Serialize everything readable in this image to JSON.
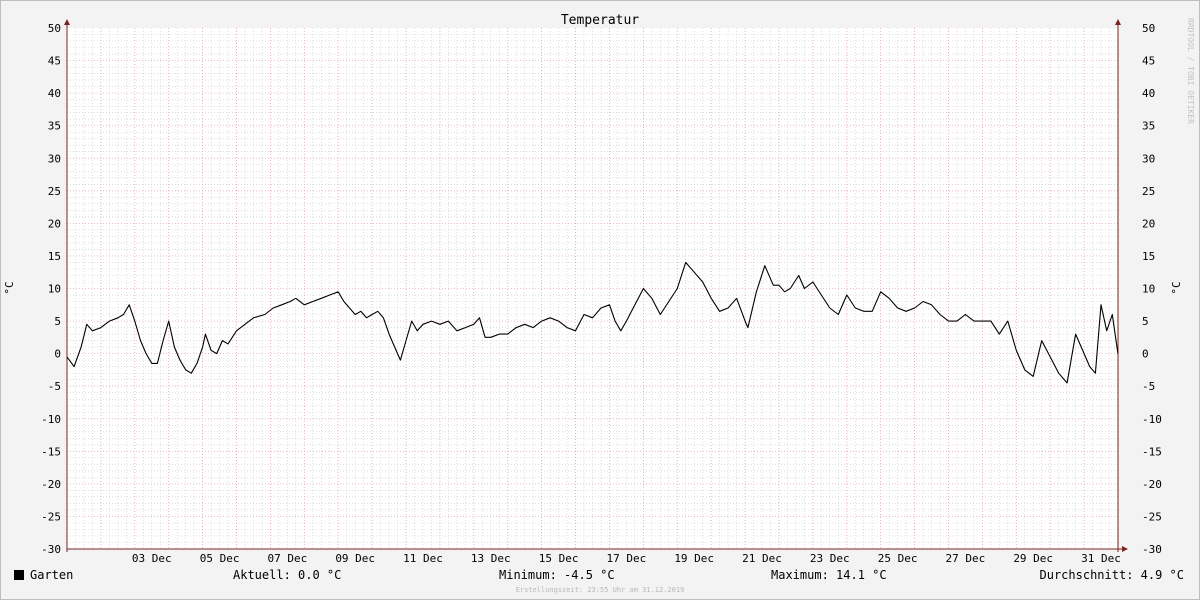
{
  "chart_data": {
    "type": "line",
    "title": "Temperatur",
    "ylabel": "°C",
    "ylim": [
      -30,
      50
    ],
    "yticks": [
      50,
      45,
      40,
      35,
      30,
      25,
      20,
      15,
      10,
      5,
      0,
      -5,
      -10,
      -15,
      -20,
      -25,
      -30
    ],
    "xlim": [
      "2019-12-01",
      "2020-01-01"
    ],
    "xticks": [
      {
        "date": "2019-12-03",
        "label": "03 Dec"
      },
      {
        "date": "2019-12-05",
        "label": "05 Dec"
      },
      {
        "date": "2019-12-07",
        "label": "07 Dec"
      },
      {
        "date": "2019-12-09",
        "label": "09 Dec"
      },
      {
        "date": "2019-12-11",
        "label": "11 Dec"
      },
      {
        "date": "2019-12-13",
        "label": "13 Dec"
      },
      {
        "date": "2019-12-15",
        "label": "15 Dec"
      },
      {
        "date": "2019-12-17",
        "label": "17 Dec"
      },
      {
        "date": "2019-12-19",
        "label": "19 Dec"
      },
      {
        "date": "2019-12-21",
        "label": "21 Dec"
      },
      {
        "date": "2019-12-23",
        "label": "23 Dec"
      },
      {
        "date": "2019-12-25",
        "label": "25 Dec"
      },
      {
        "date": "2019-12-27",
        "label": "27 Dec"
      },
      {
        "date": "2019-12-29",
        "label": "29 Dec"
      },
      {
        "date": "2019-12-31",
        "label": "31 Dec"
      }
    ],
    "grid": true,
    "series": [
      {
        "name": "Garten",
        "color": "#000000",
        "points": [
          [
            "2019-12-01 00:00",
            -0.5
          ],
          [
            "2019-12-01 05:00",
            -2.0
          ],
          [
            "2019-12-01 10:00",
            1.0
          ],
          [
            "2019-12-01 14:00",
            4.5
          ],
          [
            "2019-12-01 18:00",
            3.5
          ],
          [
            "2019-12-02 00:00",
            4.0
          ],
          [
            "2019-12-02 06:00",
            5.0
          ],
          [
            "2019-12-02 12:00",
            5.5
          ],
          [
            "2019-12-02 16:00",
            6.0
          ],
          [
            "2019-12-02 20:00",
            7.5
          ],
          [
            "2019-12-03 00:00",
            5.0
          ],
          [
            "2019-12-03 04:00",
            2.0
          ],
          [
            "2019-12-03 08:00",
            0.0
          ],
          [
            "2019-12-03 12:00",
            -1.5
          ],
          [
            "2019-12-03 16:00",
            -1.5
          ],
          [
            "2019-12-03 20:00",
            2.0
          ],
          [
            "2019-12-04 00:00",
            5.0
          ],
          [
            "2019-12-04 04:00",
            1.0
          ],
          [
            "2019-12-04 08:00",
            -1.0
          ],
          [
            "2019-12-04 12:00",
            -2.5
          ],
          [
            "2019-12-04 16:00",
            -3.0
          ],
          [
            "2019-12-04 20:00",
            -1.5
          ],
          [
            "2019-12-05 00:00",
            1.0
          ],
          [
            "2019-12-05 02:00",
            3.0
          ],
          [
            "2019-12-05 06:00",
            0.5
          ],
          [
            "2019-12-05 10:00",
            0.0
          ],
          [
            "2019-12-05 14:00",
            2.0
          ],
          [
            "2019-12-05 18:00",
            1.5
          ],
          [
            "2019-12-06 00:00",
            3.5
          ],
          [
            "2019-12-06 06:00",
            4.5
          ],
          [
            "2019-12-06 12:00",
            5.5
          ],
          [
            "2019-12-06 20:00",
            6.0
          ],
          [
            "2019-12-07 02:00",
            7.0
          ],
          [
            "2019-12-07 08:00",
            7.5
          ],
          [
            "2019-12-07 14:00",
            8.0
          ],
          [
            "2019-12-07 18:00",
            8.5
          ],
          [
            "2019-12-08 00:00",
            7.5
          ],
          [
            "2019-12-08 06:00",
            8.0
          ],
          [
            "2019-12-08 12:00",
            8.5
          ],
          [
            "2019-12-08 18:00",
            9.0
          ],
          [
            "2019-12-09 00:00",
            9.5
          ],
          [
            "2019-12-09 04:00",
            8.0
          ],
          [
            "2019-12-09 08:00",
            7.0
          ],
          [
            "2019-12-09 12:00",
            6.0
          ],
          [
            "2019-12-09 16:00",
            6.5
          ],
          [
            "2019-12-09 20:00",
            5.5
          ],
          [
            "2019-12-10 00:00",
            6.0
          ],
          [
            "2019-12-10 04:00",
            6.5
          ],
          [
            "2019-12-10 08:00",
            5.5
          ],
          [
            "2019-12-10 12:00",
            3.0
          ],
          [
            "2019-12-10 16:00",
            1.0
          ],
          [
            "2019-12-10 20:00",
            -1.0
          ],
          [
            "2019-12-11 00:00",
            2.0
          ],
          [
            "2019-12-11 04:00",
            5.0
          ],
          [
            "2019-12-11 08:00",
            3.5
          ],
          [
            "2019-12-11 12:00",
            4.5
          ],
          [
            "2019-12-11 18:00",
            5.0
          ],
          [
            "2019-12-12 00:00",
            4.5
          ],
          [
            "2019-12-12 06:00",
            5.0
          ],
          [
            "2019-12-12 12:00",
            3.5
          ],
          [
            "2019-12-12 18:00",
            4.0
          ],
          [
            "2019-12-13 00:00",
            4.5
          ],
          [
            "2019-12-13 04:00",
            5.5
          ],
          [
            "2019-12-13 08:00",
            2.5
          ],
          [
            "2019-12-13 12:00",
            2.5
          ],
          [
            "2019-12-13 18:00",
            3.0
          ],
          [
            "2019-12-14 00:00",
            3.0
          ],
          [
            "2019-12-14 06:00",
            4.0
          ],
          [
            "2019-12-14 12:00",
            4.5
          ],
          [
            "2019-12-14 18:00",
            4.0
          ],
          [
            "2019-12-15 00:00",
            5.0
          ],
          [
            "2019-12-15 06:00",
            5.5
          ],
          [
            "2019-12-15 12:00",
            5.0
          ],
          [
            "2019-12-15 18:00",
            4.0
          ],
          [
            "2019-12-16 00:00",
            3.5
          ],
          [
            "2019-12-16 06:00",
            6.0
          ],
          [
            "2019-12-16 12:00",
            5.5
          ],
          [
            "2019-12-16 18:00",
            7.0
          ],
          [
            "2019-12-17 00:00",
            7.5
          ],
          [
            "2019-12-17 04:00",
            5.0
          ],
          [
            "2019-12-17 08:00",
            3.5
          ],
          [
            "2019-12-17 12:00",
            5.0
          ],
          [
            "2019-12-17 18:00",
            7.5
          ],
          [
            "2019-12-18 00:00",
            10.0
          ],
          [
            "2019-12-18 06:00",
            8.5
          ],
          [
            "2019-12-18 12:00",
            6.0
          ],
          [
            "2019-12-18 18:00",
            8.0
          ],
          [
            "2019-12-19 00:00",
            10.0
          ],
          [
            "2019-12-19 06:00",
            14.0
          ],
          [
            "2019-12-19 12:00",
            12.5
          ],
          [
            "2019-12-19 18:00",
            11.0
          ],
          [
            "2019-12-20 00:00",
            8.5
          ],
          [
            "2019-12-20 06:00",
            6.5
          ],
          [
            "2019-12-20 12:00",
            7.0
          ],
          [
            "2019-12-20 18:00",
            8.5
          ],
          [
            "2019-12-21 00:00",
            5.0
          ],
          [
            "2019-12-21 02:00",
            4.0
          ],
          [
            "2019-12-21 08:00",
            9.5
          ],
          [
            "2019-12-21 14:00",
            13.5
          ],
          [
            "2019-12-21 20:00",
            10.5
          ],
          [
            "2019-12-22 00:00",
            10.5
          ],
          [
            "2019-12-22 04:00",
            9.5
          ],
          [
            "2019-12-22 08:00",
            10.0
          ],
          [
            "2019-12-22 14:00",
            12.0
          ],
          [
            "2019-12-22 18:00",
            10.0
          ],
          [
            "2019-12-23 00:00",
            11.0
          ],
          [
            "2019-12-23 06:00",
            9.0
          ],
          [
            "2019-12-23 12:00",
            7.0
          ],
          [
            "2019-12-23 18:00",
            6.0
          ],
          [
            "2019-12-24 00:00",
            9.0
          ],
          [
            "2019-12-24 06:00",
            7.0
          ],
          [
            "2019-12-24 12:00",
            6.5
          ],
          [
            "2019-12-24 18:00",
            6.5
          ],
          [
            "2019-12-25 00:00",
            9.5
          ],
          [
            "2019-12-25 06:00",
            8.5
          ],
          [
            "2019-12-25 12:00",
            7.0
          ],
          [
            "2019-12-25 18:00",
            6.5
          ],
          [
            "2019-12-26 00:00",
            7.0
          ],
          [
            "2019-12-26 06:00",
            8.0
          ],
          [
            "2019-12-26 12:00",
            7.5
          ],
          [
            "2019-12-26 18:00",
            6.0
          ],
          [
            "2019-12-27 00:00",
            5.0
          ],
          [
            "2019-12-27 06:00",
            5.0
          ],
          [
            "2019-12-27 12:00",
            6.0
          ],
          [
            "2019-12-27 18:00",
            5.0
          ],
          [
            "2019-12-28 00:00",
            5.0
          ],
          [
            "2019-12-28 06:00",
            5.0
          ],
          [
            "2019-12-28 12:00",
            3.0
          ],
          [
            "2019-12-28 18:00",
            5.0
          ],
          [
            "2019-12-29 00:00",
            0.5
          ],
          [
            "2019-12-29 06:00",
            -2.5
          ],
          [
            "2019-12-29 12:00",
            -3.5
          ],
          [
            "2019-12-29 18:00",
            2.0
          ],
          [
            "2019-12-30 00:00",
            -0.5
          ],
          [
            "2019-12-30 06:00",
            -3.0
          ],
          [
            "2019-12-30 12:00",
            -4.5
          ],
          [
            "2019-12-30 18:00",
            3.0
          ],
          [
            "2019-12-31 00:00",
            0.0
          ],
          [
            "2019-12-31 04:00",
            -2.0
          ],
          [
            "2019-12-31 08:00",
            -3.0
          ],
          [
            "2019-12-31 12:00",
            7.5
          ],
          [
            "2019-12-31 16:00",
            3.5
          ],
          [
            "2019-12-31 20:00",
            6.0
          ],
          [
            "2019-12-31 23:55",
            0.0
          ]
        ]
      }
    ],
    "legend": {
      "position": "bottom",
      "series_label": "Garten",
      "current": "Aktuell: 0.0 °C",
      "minimum": "Minimum: -4.5 °C",
      "maximum": "Maximum: 14.1 °C",
      "average": "Durchschnitt: 4.9 °C"
    },
    "watermark": "RRDTOOL / TOBI OETIKER",
    "footer": "Erstellungszeit: 23:55 Uhr am 31.12.2019",
    "colors": {
      "background": "#f3f3f3",
      "plot_background": "#ffffff",
      "major_grid": "#e5a8b2",
      "minor_grid": "#c8c8c8",
      "axis": "#7a2323",
      "line": "#000000"
    }
  }
}
